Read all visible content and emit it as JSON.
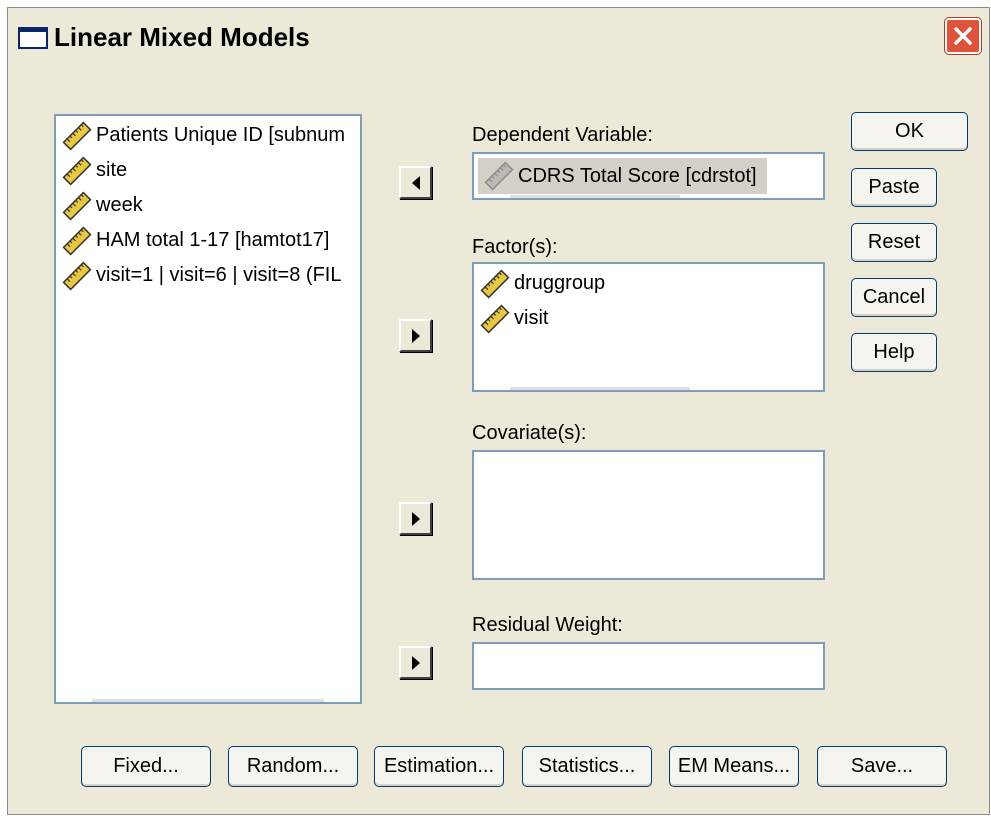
{
  "window": {
    "title": "Linear Mixed Models",
    "close_icon": "close-icon"
  },
  "source_list": {
    "items": [
      "Patients Unique ID [subnum",
      "site",
      "week",
      "HAM total 1-17 [hamtot17]",
      "visit=1 | visit=6 | visit=8 (FIL"
    ]
  },
  "dependent": {
    "label": "Dependent Variable:",
    "value": "CDRS Total Score [cdrstot]"
  },
  "factors": {
    "label": "Factor(s):",
    "items": [
      "druggroup",
      "visit"
    ]
  },
  "covariates": {
    "label": "Covariate(s):"
  },
  "residual": {
    "label": "Residual Weight:"
  },
  "buttons": {
    "ok": "OK",
    "paste": "Paste",
    "reset": "Reset",
    "cancel": "Cancel",
    "help": "Help"
  },
  "bottom_buttons": {
    "fixed": "Fixed...",
    "random": "Random...",
    "estimation": "Estimation...",
    "statistics": "Statistics...",
    "em_means": "EM Means...",
    "save": "Save..."
  },
  "colors": {
    "dialog_bg": "#ece9d8",
    "border": "#7f9db9",
    "selected_bg": "#d4d0c8",
    "ruler_yellow": "#e8c840"
  }
}
